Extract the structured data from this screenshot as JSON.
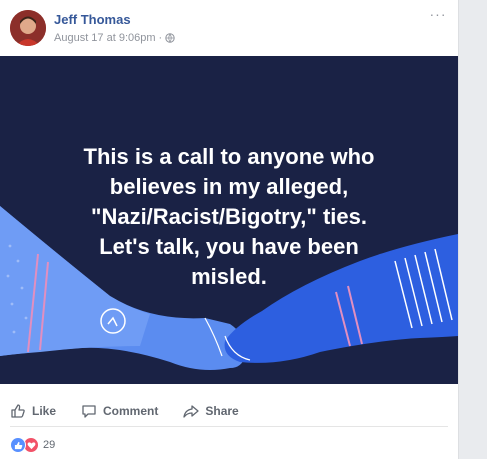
{
  "post": {
    "author": "Jeff Thomas",
    "timestamp": "August 17 at 9:06pm",
    "separator": "·",
    "privacy_icon": "globe-icon",
    "more_label": "···"
  },
  "image": {
    "text": "This is a call to anyone who\nbelieves in my alleged,\n\"Nazi/Racist/Bigotry,\" ties.\nLet's talk, you have been\nmisled.",
    "colors": {
      "background": "#1a2245",
      "arm_left": "#5b8cf0",
      "arm_right": "#2d5fe0",
      "stripe": "#e28fc0"
    }
  },
  "actions": [
    {
      "label": "Like",
      "icon": "thumbs-up-icon"
    },
    {
      "label": "Comment",
      "icon": "comment-icon"
    },
    {
      "label": "Share",
      "icon": "share-icon"
    }
  ],
  "reactions": {
    "icons": [
      "like-reaction-icon",
      "love-reaction-icon"
    ],
    "count": "29"
  },
  "colors": {
    "link": "#365899",
    "muted": "#90949c",
    "action": "#616770"
  }
}
